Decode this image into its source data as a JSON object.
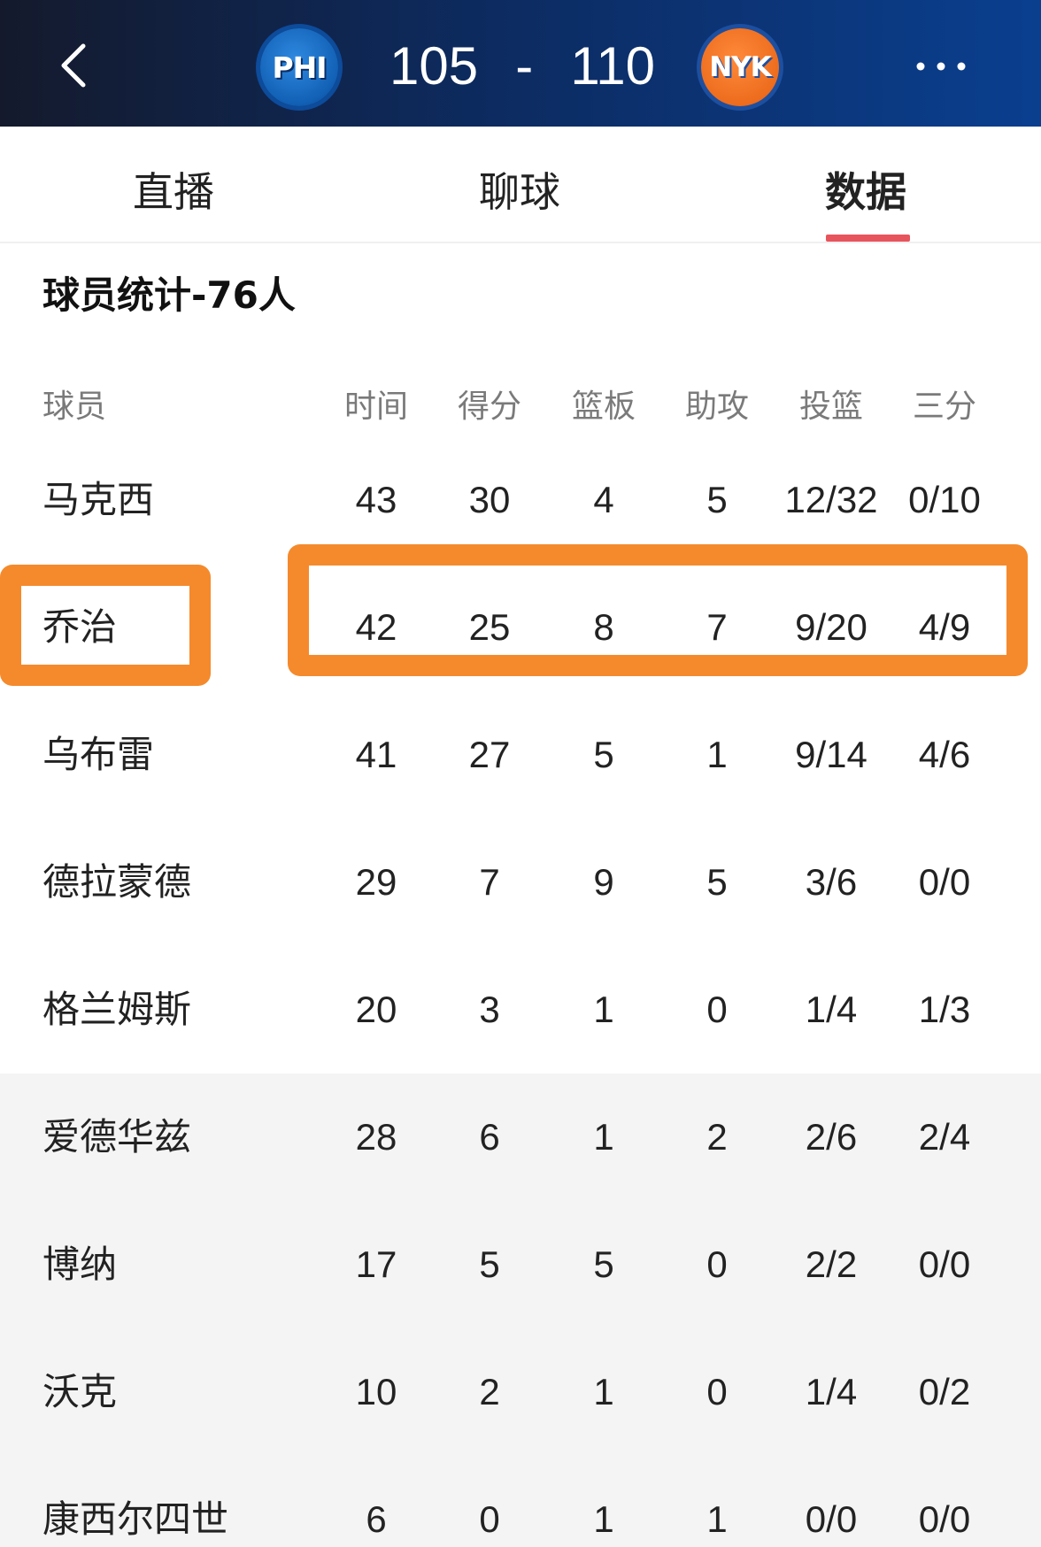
{
  "header": {
    "home_team_abbr": "PHI",
    "away_team_abbr": "NYK",
    "home_score": "105",
    "separator": "-",
    "away_score": "110"
  },
  "tabs": [
    "直播",
    "聊球",
    "数据"
  ],
  "active_tab": "数据",
  "section_title": "球员统计-76人",
  "columns": [
    "球员",
    "时间",
    "得分",
    "篮板",
    "助攻",
    "投篮",
    "三分"
  ],
  "players": [
    {
      "name": "马克西",
      "time": "43",
      "pts": "30",
      "reb": "4",
      "ast": "5",
      "fg": "12/32",
      "tp": "0/10"
    },
    {
      "name": "乔治",
      "time": "42",
      "pts": "25",
      "reb": "8",
      "ast": "7",
      "fg": "9/20",
      "tp": "4/9"
    },
    {
      "name": "乌布雷",
      "time": "41",
      "pts": "27",
      "reb": "5",
      "ast": "1",
      "fg": "9/14",
      "tp": "4/6"
    },
    {
      "name": "德拉蒙德",
      "time": "29",
      "pts": "7",
      "reb": "9",
      "ast": "5",
      "fg": "3/6",
      "tp": "0/0"
    },
    {
      "name": "格兰姆斯",
      "time": "20",
      "pts": "3",
      "reb": "1",
      "ast": "0",
      "fg": "1/4",
      "tp": "1/3"
    },
    {
      "name": "爱德华兹",
      "time": "28",
      "pts": "6",
      "reb": "1",
      "ast": "2",
      "fg": "2/6",
      "tp": "2/4"
    },
    {
      "name": "博纳",
      "time": "17",
      "pts": "5",
      "reb": "5",
      "ast": "0",
      "fg": "2/2",
      "tp": "0/0"
    },
    {
      "name": "沃克",
      "time": "10",
      "pts": "2",
      "reb": "1",
      "ast": "0",
      "fg": "1/4",
      "tp": "0/2"
    },
    {
      "name": "康西尔四世",
      "time": "6",
      "pts": "0",
      "reb": "1",
      "ast": "1",
      "fg": "0/0",
      "tp": "0/0"
    }
  ],
  "colors": {
    "header_bg_start": "#141a2c",
    "header_bg_end": "#0a3f8f",
    "tab_underline": "#e8545b",
    "highlight": "#f58a2c",
    "bench_row_bg": "#f4f4f4"
  }
}
